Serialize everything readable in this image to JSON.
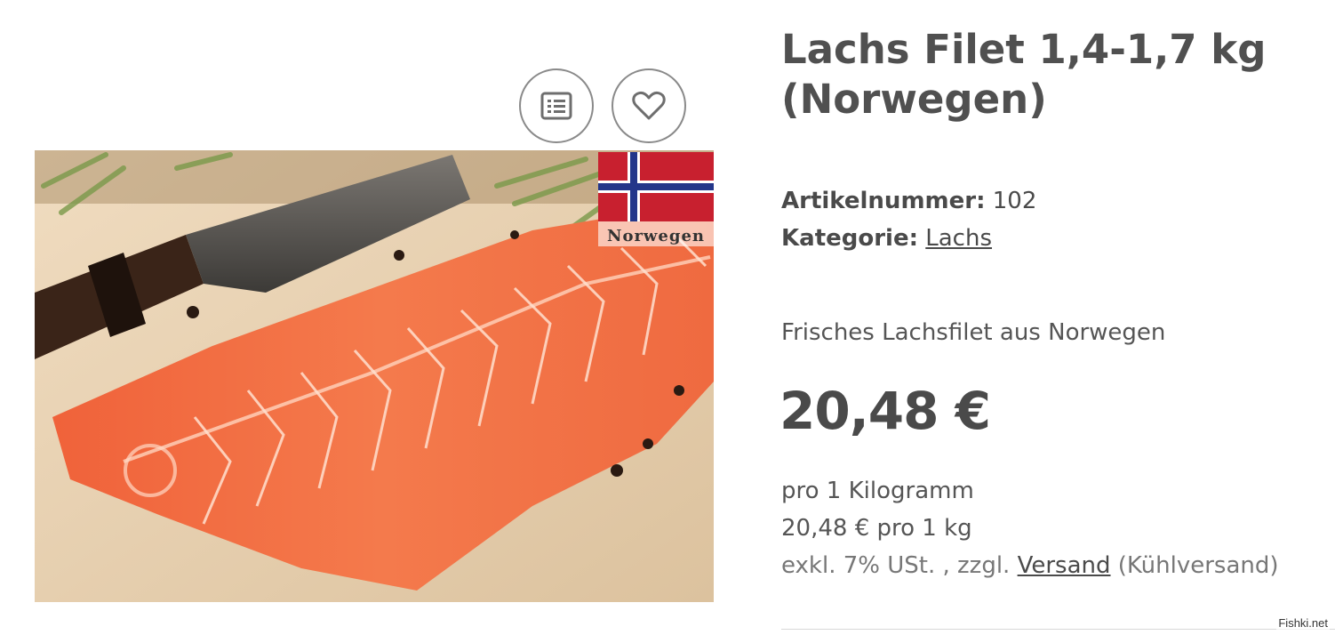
{
  "product": {
    "title": "Lachs Filet 1,4-1,7 kg (Norwegen)",
    "sku_label": "Artikelnummer:",
    "sku_value": "102",
    "category_label": "Kategorie:",
    "category_link": "Lachs",
    "description": "Frisches Lachsfilet aus Norwegen",
    "price": "20,48 €",
    "unit_line_1": "pro 1 Kilogramm",
    "unit_line_2": "20,48 € pro 1 kg",
    "tax_text": "exkl. 7% USt. , zzgl.",
    "shipping_link": "Versand",
    "shipping_note": "(Kühlversand)"
  },
  "image": {
    "flag_label": "Norwegen",
    "flag_colors": {
      "red": "#c8202f",
      "blue": "#24368a",
      "white": "#ffffff"
    }
  },
  "actions": {
    "compare_icon": "list-icon",
    "wishlist_icon": "heart-icon"
  },
  "watermark": "Fishki.net"
}
